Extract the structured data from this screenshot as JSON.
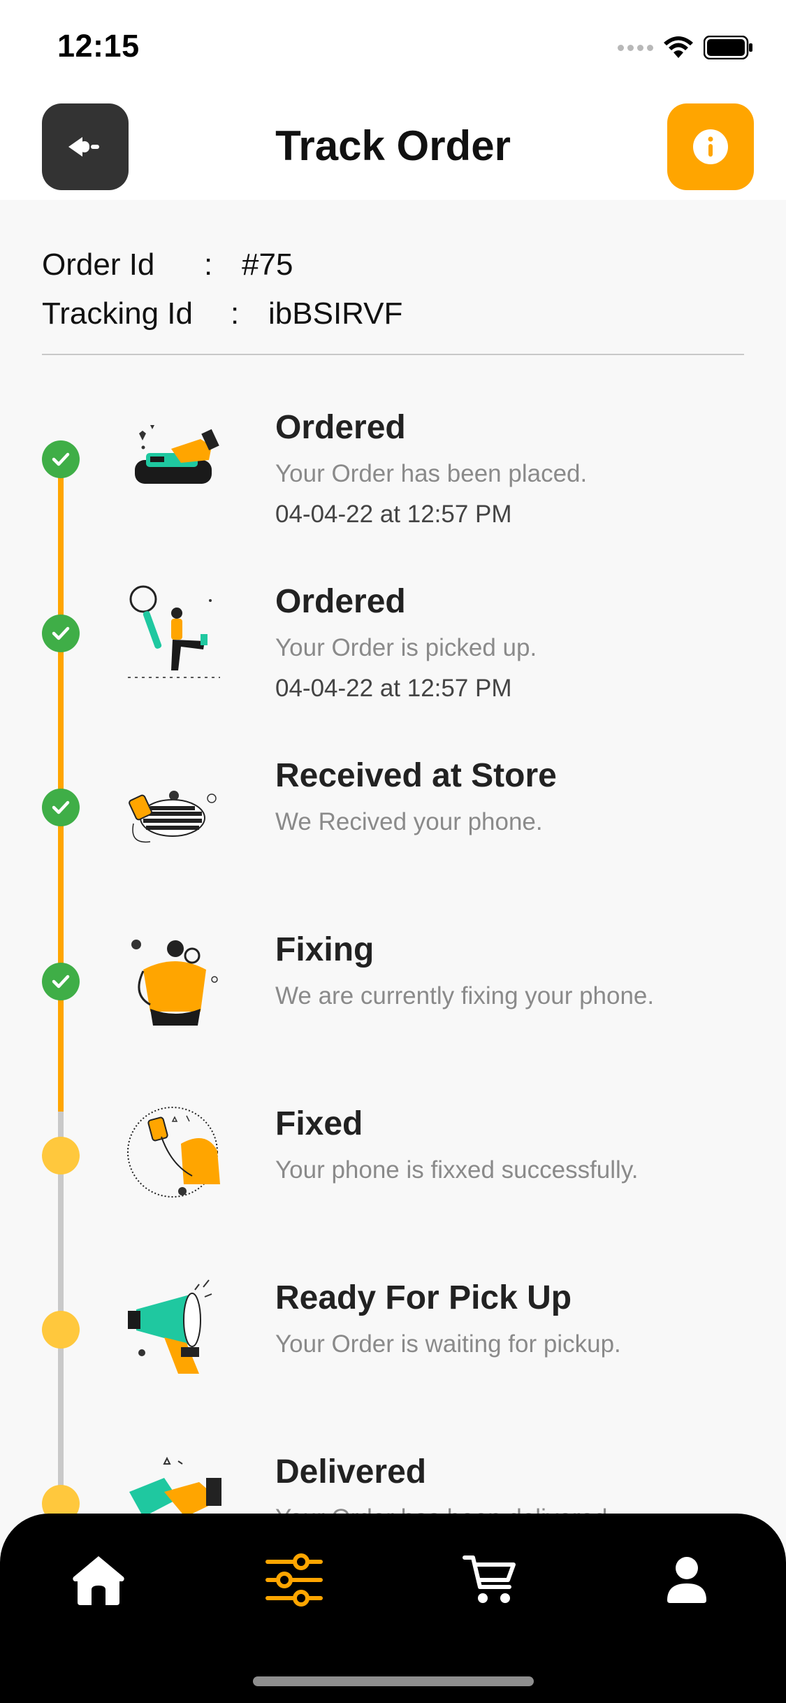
{
  "status_bar": {
    "time": "12:15"
  },
  "header": {
    "title": "Track Order",
    "back_icon": "back-arrow-icon",
    "info_icon": "info-icon"
  },
  "order": {
    "order_id_label": "Order Id",
    "order_id_sep": ":",
    "order_id_value": "#75",
    "tracking_id_label": "Tracking Id",
    "tracking_id_sep": ":",
    "tracking_id_value": "ibBSIRVF"
  },
  "timeline": [
    {
      "title": "Ordered",
      "desc": "Your Order has been placed.",
      "date": "04-04-22 at 12:57 PM",
      "status": "done",
      "illustration": "payment-card-illustration"
    },
    {
      "title": "Ordered",
      "desc": "Your Order is picked up.",
      "date": "04-04-22 at 12:57 PM",
      "status": "done",
      "illustration": "search-person-illustration"
    },
    {
      "title": "Received at Store",
      "desc": "We Recived your phone.",
      "date": "",
      "status": "done",
      "illustration": "store-receive-illustration"
    },
    {
      "title": "Fixing",
      "desc": "We are currently fixing your phone.",
      "date": "",
      "status": "done",
      "illustration": "repair-person-illustration"
    },
    {
      "title": "Fixed",
      "desc": "Your phone is fixxed successfully.",
      "date": "",
      "status": "pending",
      "illustration": "phone-fixed-illustration"
    },
    {
      "title": "Ready For Pick Up",
      "desc": "Your Order is waiting for pickup.",
      "date": "",
      "status": "pending",
      "illustration": "megaphone-illustration"
    },
    {
      "title": "Delivered",
      "desc": "Your Order has been delivered.",
      "date": "",
      "status": "pending",
      "illustration": "handshake-illustration"
    }
  ],
  "bottom_nav": [
    {
      "icon": "home-icon",
      "active": false
    },
    {
      "icon": "filter-sliders-icon",
      "active": true
    },
    {
      "icon": "cart-icon",
      "active": false
    },
    {
      "icon": "profile-icon",
      "active": false
    }
  ],
  "colors": {
    "accent": "#ffa500",
    "done": "#3fae47",
    "pending": "#ffc83d",
    "dark": "#333333",
    "nav_bg": "#000000",
    "teal": "#1fc8a0"
  }
}
